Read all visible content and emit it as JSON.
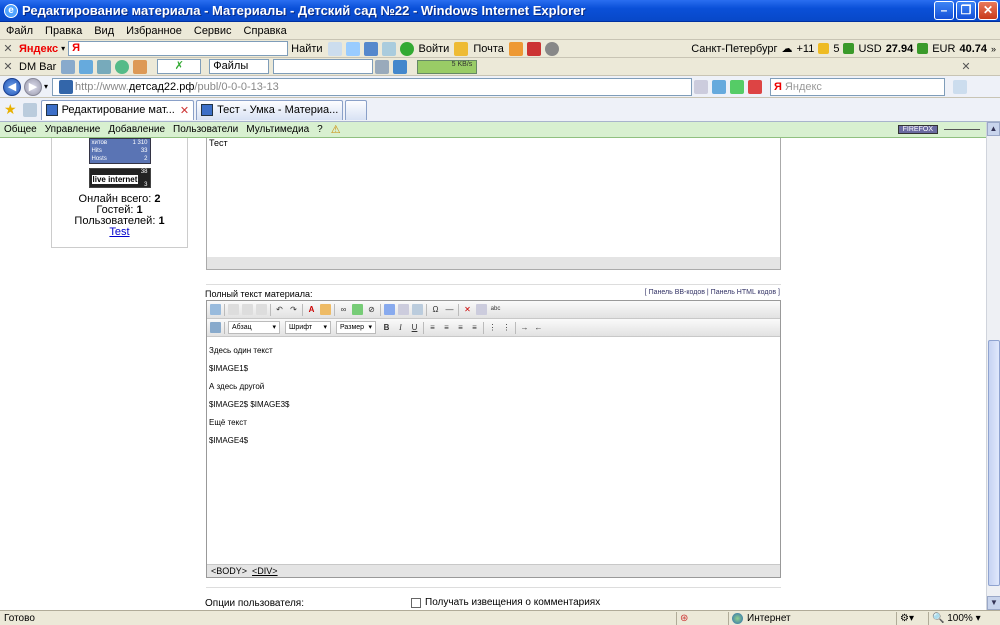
{
  "window": {
    "title": "Редактирование материала - Материалы - Детский сад №22 - Windows Internet Explorer",
    "icon": "ie-icon"
  },
  "menu": [
    "Файл",
    "Правка",
    "Вид",
    "Избранное",
    "Сервис",
    "Справка"
  ],
  "yandex_bar": {
    "brand": "Яндекс",
    "input_value": "Я",
    "find_label": "Найти",
    "login_label": "Войти",
    "mail_label": "Почта",
    "city": "Санкт-Петербург",
    "temp": "+11",
    "points": "5",
    "usd_label": "USD",
    "usd_value": "27.94",
    "eur_label": "EUR",
    "eur_value": "40.74"
  },
  "dm_bar": {
    "label": "DM Bar",
    "files_label": "Файлы",
    "speed": "5 KB/s"
  },
  "address": {
    "prefix": "http://www.",
    "domain": "детсад22.рф",
    "path": "/publ/0-0-0-13-13",
    "search_placeholder": "Яндекс"
  },
  "tabs": [
    {
      "label": "Редактирование мат...",
      "active": true
    },
    {
      "label": "Тест - Умка - Материа...",
      "active": false
    }
  ],
  "ucoz_menu": [
    "Общее",
    "Управление",
    "Добавление",
    "Пользователи",
    "Мультимедиа",
    "?"
  ],
  "firefox_badge": "FIREFOX",
  "sidebar": {
    "counter_rows": [
      {
        "label": "хитов",
        "value": "1 310"
      },
      {
        "label": "Hits",
        "value": "33"
      },
      {
        "label": "Hosts",
        "value": "2"
      }
    ],
    "liveinternet_num": "38",
    "liveinternet_label": "live internet",
    "liveinternet_num2": "3",
    "online_total_label": "Онлайн всего:",
    "online_total": "2",
    "guests_label": "Гостей:",
    "guests": "1",
    "users_label": "Пользователей:",
    "users": "1",
    "user_link": "Test"
  },
  "short_editor": {
    "text": "Тест"
  },
  "full_text": {
    "label": "Полный текст материала:",
    "bb_link": "Панель BB-кодов",
    "html_link": "Панель HTML кодов",
    "paragraph_select": "Абзац",
    "font_select": "Шрифт",
    "size_select": "Размер",
    "lines": [
      "Здесь один текст",
      "$IMAGE1$",
      "А здесь другой",
      "$IMAGE2$ $IMAGE3$",
      "Ещё текст",
      "$IMAGE4$"
    ],
    "path_body": "<BODY>",
    "path_div": "<DIV>"
  },
  "options": {
    "label": "Опции пользователя:",
    "notify_label": "Получать извещения о комментариях"
  },
  "statusbar": {
    "ready": "Готово",
    "zone": "Интернет",
    "zoom": "100%"
  },
  "colors": {
    "titlebar": "#0a50d8",
    "ucoz_bar": "#d8f0d0",
    "link": "#0000cc"
  }
}
